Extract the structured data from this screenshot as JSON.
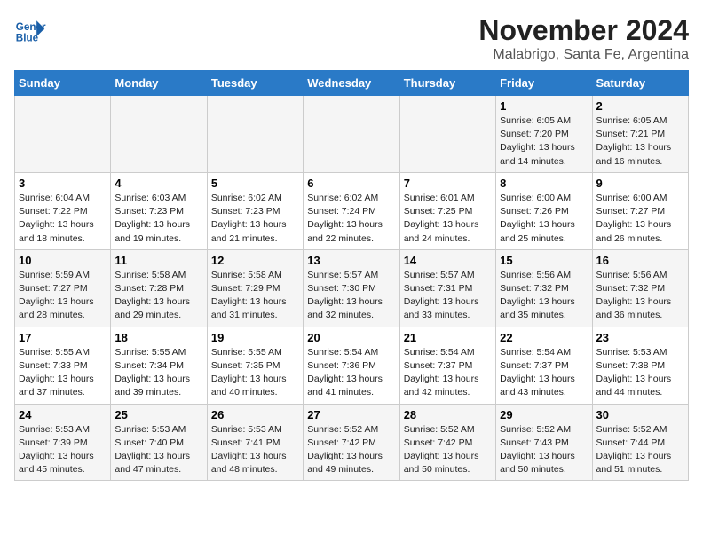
{
  "header": {
    "logo_line1": "General",
    "logo_line2": "Blue",
    "month": "November 2024",
    "location": "Malabrigo, Santa Fe, Argentina"
  },
  "days_of_week": [
    "Sunday",
    "Monday",
    "Tuesday",
    "Wednesday",
    "Thursday",
    "Friday",
    "Saturday"
  ],
  "weeks": [
    [
      {
        "day": "",
        "info": ""
      },
      {
        "day": "",
        "info": ""
      },
      {
        "day": "",
        "info": ""
      },
      {
        "day": "",
        "info": ""
      },
      {
        "day": "",
        "info": ""
      },
      {
        "day": "1",
        "info": "Sunrise: 6:05 AM\nSunset: 7:20 PM\nDaylight: 13 hours and 14 minutes."
      },
      {
        "day": "2",
        "info": "Sunrise: 6:05 AM\nSunset: 7:21 PM\nDaylight: 13 hours and 16 minutes."
      }
    ],
    [
      {
        "day": "3",
        "info": "Sunrise: 6:04 AM\nSunset: 7:22 PM\nDaylight: 13 hours and 18 minutes."
      },
      {
        "day": "4",
        "info": "Sunrise: 6:03 AM\nSunset: 7:23 PM\nDaylight: 13 hours and 19 minutes."
      },
      {
        "day": "5",
        "info": "Sunrise: 6:02 AM\nSunset: 7:23 PM\nDaylight: 13 hours and 21 minutes."
      },
      {
        "day": "6",
        "info": "Sunrise: 6:02 AM\nSunset: 7:24 PM\nDaylight: 13 hours and 22 minutes."
      },
      {
        "day": "7",
        "info": "Sunrise: 6:01 AM\nSunset: 7:25 PM\nDaylight: 13 hours and 24 minutes."
      },
      {
        "day": "8",
        "info": "Sunrise: 6:00 AM\nSunset: 7:26 PM\nDaylight: 13 hours and 25 minutes."
      },
      {
        "day": "9",
        "info": "Sunrise: 6:00 AM\nSunset: 7:27 PM\nDaylight: 13 hours and 26 minutes."
      }
    ],
    [
      {
        "day": "10",
        "info": "Sunrise: 5:59 AM\nSunset: 7:27 PM\nDaylight: 13 hours and 28 minutes."
      },
      {
        "day": "11",
        "info": "Sunrise: 5:58 AM\nSunset: 7:28 PM\nDaylight: 13 hours and 29 minutes."
      },
      {
        "day": "12",
        "info": "Sunrise: 5:58 AM\nSunset: 7:29 PM\nDaylight: 13 hours and 31 minutes."
      },
      {
        "day": "13",
        "info": "Sunrise: 5:57 AM\nSunset: 7:30 PM\nDaylight: 13 hours and 32 minutes."
      },
      {
        "day": "14",
        "info": "Sunrise: 5:57 AM\nSunset: 7:31 PM\nDaylight: 13 hours and 33 minutes."
      },
      {
        "day": "15",
        "info": "Sunrise: 5:56 AM\nSunset: 7:32 PM\nDaylight: 13 hours and 35 minutes."
      },
      {
        "day": "16",
        "info": "Sunrise: 5:56 AM\nSunset: 7:32 PM\nDaylight: 13 hours and 36 minutes."
      }
    ],
    [
      {
        "day": "17",
        "info": "Sunrise: 5:55 AM\nSunset: 7:33 PM\nDaylight: 13 hours and 37 minutes."
      },
      {
        "day": "18",
        "info": "Sunrise: 5:55 AM\nSunset: 7:34 PM\nDaylight: 13 hours and 39 minutes."
      },
      {
        "day": "19",
        "info": "Sunrise: 5:55 AM\nSunset: 7:35 PM\nDaylight: 13 hours and 40 minutes."
      },
      {
        "day": "20",
        "info": "Sunrise: 5:54 AM\nSunset: 7:36 PM\nDaylight: 13 hours and 41 minutes."
      },
      {
        "day": "21",
        "info": "Sunrise: 5:54 AM\nSunset: 7:37 PM\nDaylight: 13 hours and 42 minutes."
      },
      {
        "day": "22",
        "info": "Sunrise: 5:54 AM\nSunset: 7:37 PM\nDaylight: 13 hours and 43 minutes."
      },
      {
        "day": "23",
        "info": "Sunrise: 5:53 AM\nSunset: 7:38 PM\nDaylight: 13 hours and 44 minutes."
      }
    ],
    [
      {
        "day": "24",
        "info": "Sunrise: 5:53 AM\nSunset: 7:39 PM\nDaylight: 13 hours and 45 minutes."
      },
      {
        "day": "25",
        "info": "Sunrise: 5:53 AM\nSunset: 7:40 PM\nDaylight: 13 hours and 47 minutes."
      },
      {
        "day": "26",
        "info": "Sunrise: 5:53 AM\nSunset: 7:41 PM\nDaylight: 13 hours and 48 minutes."
      },
      {
        "day": "27",
        "info": "Sunrise: 5:52 AM\nSunset: 7:42 PM\nDaylight: 13 hours and 49 minutes."
      },
      {
        "day": "28",
        "info": "Sunrise: 5:52 AM\nSunset: 7:42 PM\nDaylight: 13 hours and 50 minutes."
      },
      {
        "day": "29",
        "info": "Sunrise: 5:52 AM\nSunset: 7:43 PM\nDaylight: 13 hours and 50 minutes."
      },
      {
        "day": "30",
        "info": "Sunrise: 5:52 AM\nSunset: 7:44 PM\nDaylight: 13 hours and 51 minutes."
      }
    ]
  ]
}
